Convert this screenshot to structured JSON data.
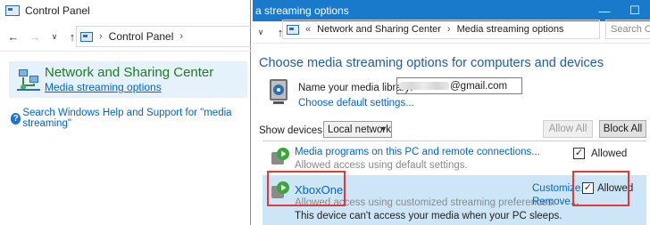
{
  "left_window": {
    "title": "Control Panel",
    "breadcrumb": "Control Panel",
    "result": {
      "title": "Network and Sharing Center",
      "link": "Media streaming options"
    },
    "help_link": "Search Windows Help and Support for \"media streaming\""
  },
  "right_window": {
    "title": "a streaming options",
    "breadcrumb_1": "Network and Sharing Center",
    "breadcrumb_2": "Media streaming options",
    "search_placeholder": "Search Co",
    "heading": "Choose media streaming options for computers and devices",
    "library_label": "Name your media library:",
    "library_value_suffix": "@gmail.com",
    "default_settings_link": "Choose default settings...",
    "show_devices_label": "Show devices on:",
    "network_select": "Local network",
    "allow_all": "Allow All",
    "block_all": "Block All",
    "devices": [
      {
        "title": "Media programs on this PC and remote connections...",
        "subtitle": "Allowed access using default settings.",
        "allowed_label": "Allowed",
        "checked": true
      },
      {
        "title": "XboxOne",
        "subtitle": "Allowed access using customized streaming preferences.",
        "note": "This device can't access your media when your PC sleeps.",
        "customize": "Customize...",
        "remove": "Remove...",
        "allowed_label": "Allowed",
        "checked": true
      }
    ]
  },
  "colors": {
    "title_blue": "#1979ca",
    "heading_blue": "#1e5ea8",
    "link_blue": "#0066cc",
    "result_green": "#1e7d1e",
    "highlight": "#cde6f7",
    "annotation_red": "#e03a3a"
  }
}
